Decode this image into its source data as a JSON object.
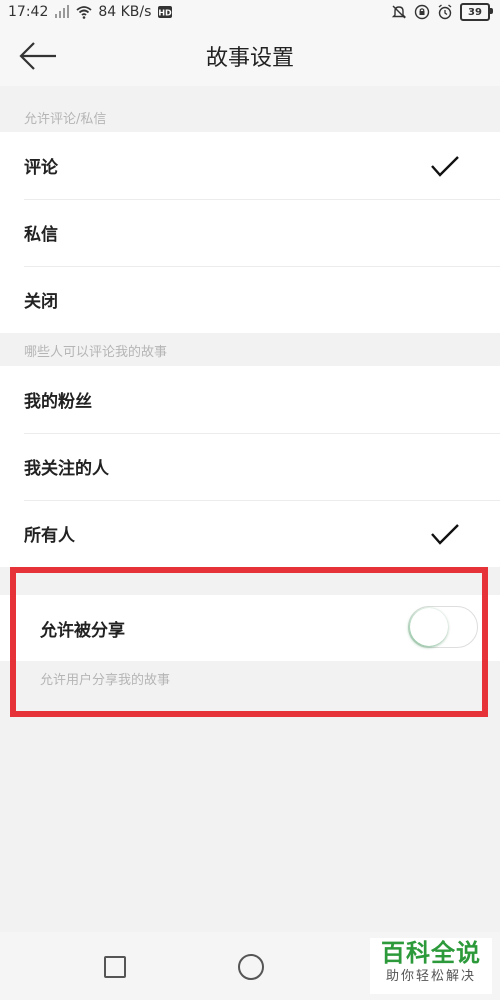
{
  "status_bar": {
    "time": "17:42",
    "network_speed": "84 KB/s",
    "battery": "39",
    "icons": [
      "signal-icon",
      "wifi-icon",
      "hd-icon",
      "bell-off-icon",
      "lock-rotation-icon",
      "alarm-icon",
      "battery-icon"
    ]
  },
  "header": {
    "title": "故事设置",
    "back_icon": "arrow-left-icon"
  },
  "sections": [
    {
      "header": "允许评论/私信",
      "items": [
        {
          "label": "评论",
          "checked": true
        },
        {
          "label": "私信",
          "checked": false
        },
        {
          "label": "关闭",
          "checked": false
        }
      ]
    },
    {
      "header": "哪些人可以评论我的故事",
      "items": [
        {
          "label": "我的粉丝",
          "checked": false
        },
        {
          "label": "我关注的人",
          "checked": false
        },
        {
          "label": "所有人",
          "checked": true
        }
      ]
    }
  ],
  "share": {
    "label": "允许被分享",
    "hint": "允许用户分享我的故事",
    "enabled": false
  },
  "watermark": {
    "title": "百科全说",
    "subtitle": "助你轻松解决"
  },
  "colors": {
    "highlight": "#e6333a",
    "toggle_accent": "#2ca050",
    "watermark_green": "#2c9a3a"
  }
}
